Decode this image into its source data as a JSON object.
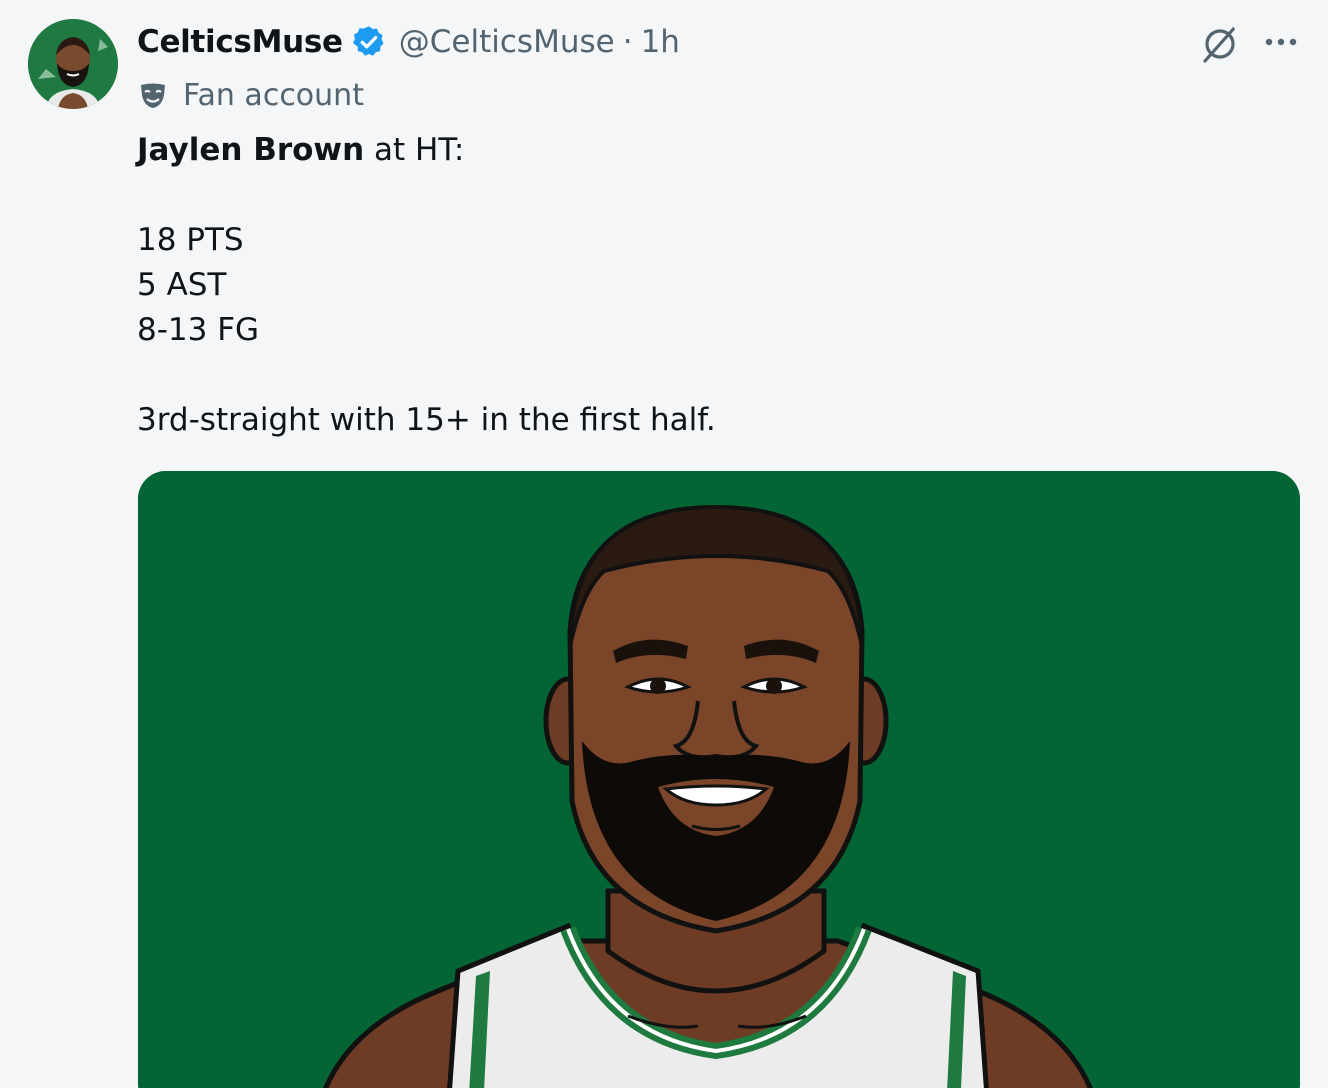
{
  "author": {
    "display_name": "CelticsMuse",
    "handle": "@CelticsMuse",
    "separator": "·",
    "time": "1h",
    "label": "Fan account",
    "avatar_icon": "player-avatar",
    "verified_icon": "verified-badge-icon"
  },
  "tweet": {
    "headline_bold": "Jaylen Brown",
    "headline_rest": " at HT:",
    "stats": [
      "18 PTS",
      "5 AST",
      "8-13 FG"
    ],
    "note": "3rd-straight with 15+ in the first half."
  },
  "actions": {
    "grok_icon": "grok-icon",
    "more_icon": "more-icon"
  },
  "media": {
    "alt": "illustrated-player-portrait",
    "background_color": "#036534"
  },
  "colors": {
    "verified": "#1d9bf0",
    "muted_text": "#536471",
    "celtics_green": "#036534"
  }
}
